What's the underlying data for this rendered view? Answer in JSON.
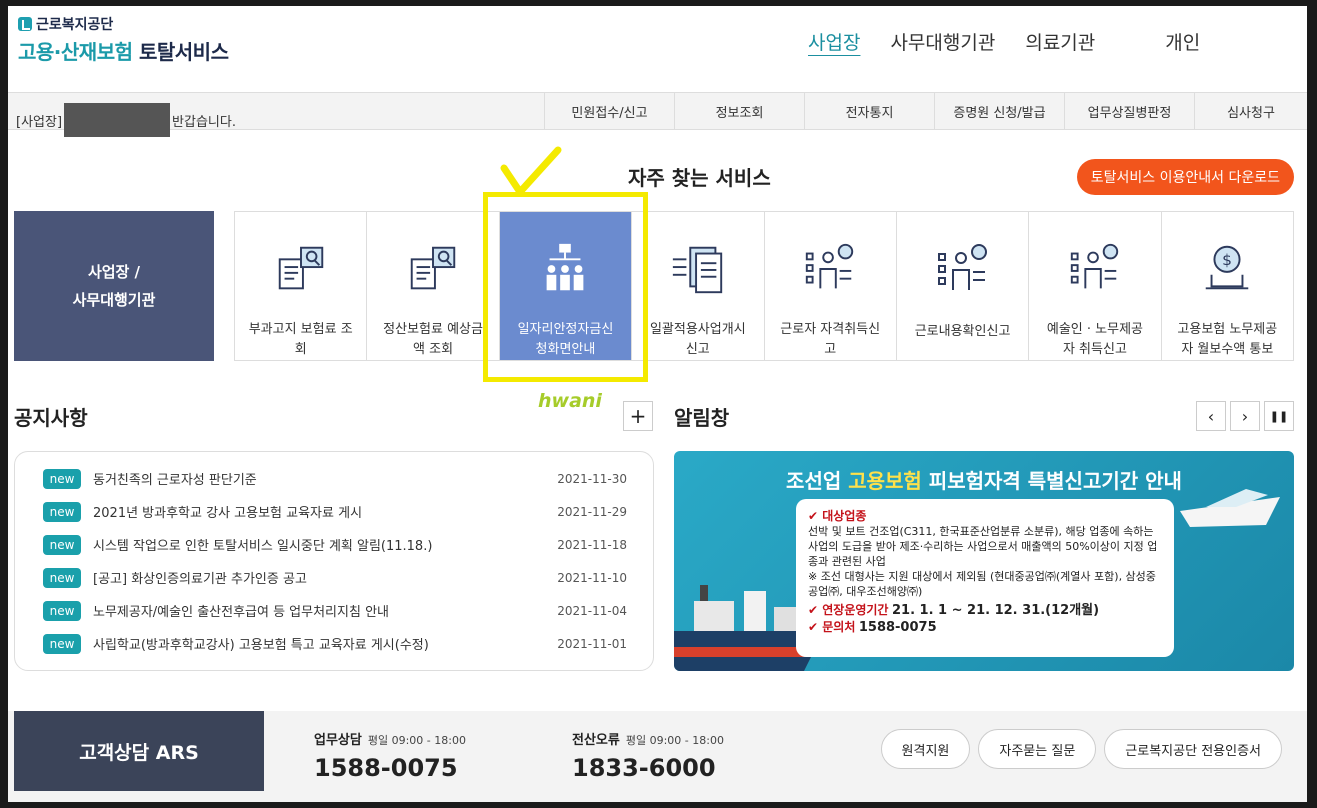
{
  "header": {
    "org_name": "근로복지공단",
    "title_part1": "고용·산재보험",
    "title_part2": "토탈서비스",
    "nav": [
      "사업장",
      "사무대행기관",
      "의료기관",
      "개인"
    ]
  },
  "subbar": {
    "greeting_prefix": "[사업장]",
    "greeting_suffix": "반갑습니다.",
    "menu": [
      "민원접수/신고",
      "정보조회",
      "전자통지",
      "증명원 신청/발급",
      "업무상질병판정",
      "심사청구"
    ]
  },
  "services": {
    "title": "자주 찾는 서비스",
    "download_label": "토탈서비스 이용안내서 다운로드",
    "category_line1": "사업장 /",
    "category_line2": "사무대행기관",
    "items": [
      {
        "line1": "부과고지 보험료 조",
        "line2": "회",
        "icon": "document-search-icon"
      },
      {
        "line1": "정산보험료 예상금",
        "line2": "액 조회",
        "icon": "document-search-icon"
      },
      {
        "line1": "일자리안정자금신",
        "line2": "청화면안내",
        "icon": "org-chart-people-icon"
      },
      {
        "line1": "일괄적용사업개시",
        "line2": "신고",
        "icon": "document-transfer-icon"
      },
      {
        "line1": "근로자 자격취득신",
        "line2": "고",
        "icon": "person-list-icon"
      },
      {
        "line1": "근로내용확인신고",
        "line2": "",
        "icon": "person-list-icon"
      },
      {
        "line1": "예술인 · 노무제공",
        "line2": "자 취득신고",
        "icon": "person-list-icon"
      },
      {
        "line1": "고용보험 노무제공",
        "line2": "자 월보수액 통보",
        "icon": "money-laptop-icon"
      }
    ]
  },
  "annotation": {
    "signature": "hwani",
    "color": "#f4ea00"
  },
  "notice": {
    "title": "공지사항",
    "more_label": "+",
    "items": [
      {
        "badge": "new",
        "text": "동거친족의 근로자성 판단기준",
        "date": "2021-11-30"
      },
      {
        "badge": "new",
        "text": "2021년 방과후학교 강사 고용보험 교육자료 게시",
        "date": "2021-11-29"
      },
      {
        "badge": "new",
        "text": "시스템 작업으로 인한 토탈서비스 일시중단 계획 알림(11.18.)",
        "date": "2021-11-18"
      },
      {
        "badge": "new",
        "text": "[공고] 화상인증의료기관 추가인증 공고",
        "date": "2021-11-10"
      },
      {
        "badge": "new",
        "text": "노무제공자/예술인 출산전후급여 등 업무처리지침 안내",
        "date": "2021-11-04"
      },
      {
        "badge": "new",
        "text": "사립학교(방과후학교강사) 고용보험 특고 교육자료 게시(수정)",
        "date": "2021-11-01"
      }
    ]
  },
  "alarm": {
    "title": "알림창",
    "prev": "‹",
    "next": "›",
    "pause": "❚❚",
    "banner": {
      "title_a": "조선업",
      "title_b": "고용보험",
      "title_c": "피보험자격 특별신고기간 안내",
      "h1": "대상업종",
      "b1": "선박 및 보트 건조업(C311, 한국표준산업분류 소분류), 해당 업종에 속하는 사업의 도급을 받아 제조·수리하는 사업으로서 매출액의 50%이상이 지정 업종과 관련된 사업",
      "b2": "※ 조선 대형사는 지원 대상에서 제외됨 (현대중공업㈜(계열사 포함), 삼성중공업㈜, 대우조선해양㈜)",
      "h2": "연장운영기간",
      "v2": "21. 1. 1 ~ 21. 12. 31.(12개월)",
      "h3": "문의처",
      "v3": "1588-0075"
    }
  },
  "footer": {
    "ars_label": "고객상담 ARS",
    "work_label": "업무상담",
    "work_hours": "평일 09:00 - 18:00",
    "work_num": "1588-0075",
    "err_label": "전산오류",
    "err_hours": "평일 09:00 - 18:00",
    "err_num": "1833-6000",
    "buttons": [
      "원격지원",
      "자주묻는 질문",
      "근로복지공단 전용인증서"
    ]
  }
}
